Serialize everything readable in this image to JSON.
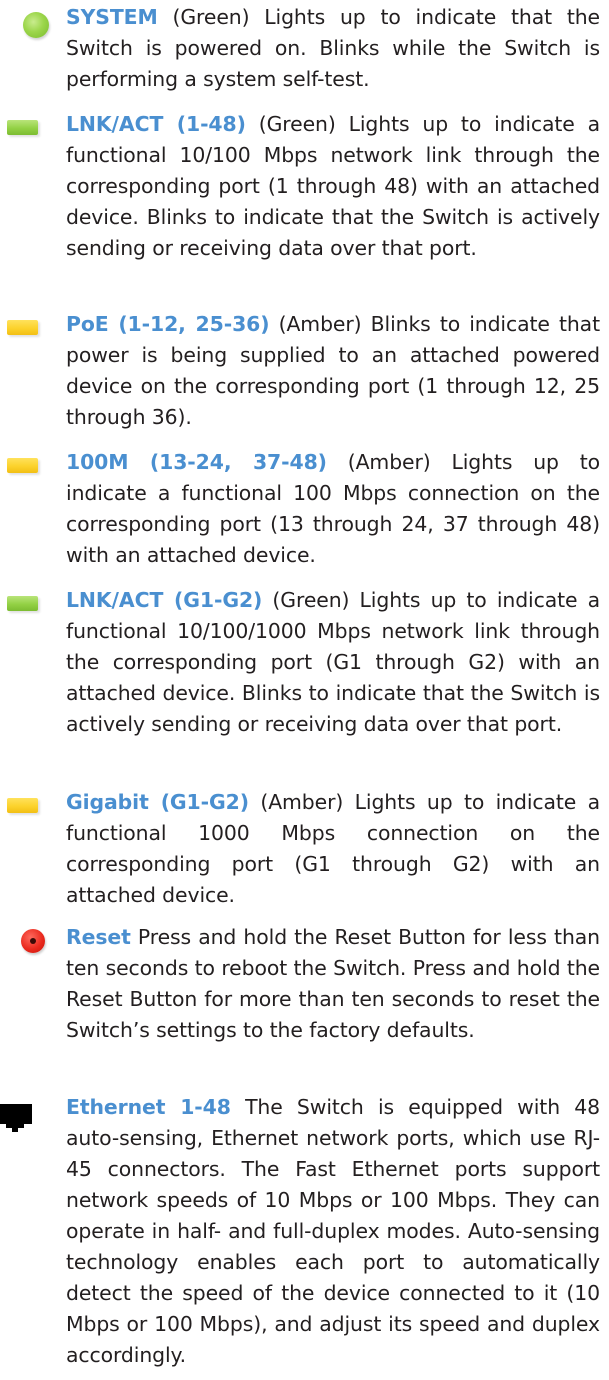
{
  "entries": [
    {
      "icon": "green-led-circle-icon",
      "color": "#9cd64b",
      "term": "SYSTEM",
      "text": " (Green) Lights up to indicate that the Switch is powered on. Blinks while the Switch is performing a system self-test."
    },
    {
      "icon": "green-led-rect-icon",
      "color": "#93d145",
      "term": "LNK/ACT (1-48)",
      "text": " (Green) Lights up to indicate a functional 10/100 Mbps network link through the corresponding port (1 through 48) with an attached device. Blinks to indicate that the Switch is actively sending or receiving data over that port."
    },
    {
      "icon": "amber-led-rect-icon",
      "color": "#fcd22c",
      "term": "PoE (1-12, 25-36)",
      "text": " (Amber) Blinks to indicate that power is being supplied to an attached powered device on the corresponding port (1 through 12, 25 through 36)."
    },
    {
      "icon": "amber-led-rect-icon",
      "color": "#fcd22c",
      "term": "100M (13-24, 37-48)",
      "text": " (Amber) Lights up to indicate a functional 100 Mbps connection on the corresponding port (13 through 24, 37 through 48) with an attached device."
    },
    {
      "icon": "green-led-rect-icon",
      "color": "#93d145",
      "term": "LNK/ACT (G1-G2)",
      "text": " (Green) Lights up to indicate a functional 10/100/1000 Mbps network link through the corresponding port (G1 through G2) with an attached device. Blinks to indicate that the Switch is actively sending or receiving data over that port."
    },
    {
      "icon": "amber-led-rect-icon",
      "color": "#fcd22c",
      "term": "Gigabit (G1-G2)",
      "text": " (Amber) Lights up to indicate a functional 1000 Mbps connection on the corresponding port (G1 through G2) with an attached device."
    },
    {
      "icon": "reset-button-icon",
      "color": "#ea2a1e",
      "term": "Reset",
      "text": " Press and hold the Reset Button for less than ten seconds to reboot the Switch. Press and hold the Reset Button for more than ten seconds to reset the Switch’s settings to the factory defaults."
    },
    {
      "icon": "ethernet-port-icon",
      "color": "#000000",
      "term": "Ethernet 1-48",
      "text": " The Switch is equipped with 48 auto-sensing, Ethernet network ports, which use RJ-45 connectors. The Fast Ethernet ports support network speeds of 10 Mbps or 100 Mbps. They can operate in half- and full-duplex modes. Auto-sensing technology enables each port to automatically detect the speed of the device connected to it (10 Mbps or 100 Mbps), and adjust its speed and duplex accordingly."
    }
  ],
  "colors": {
    "term": "#4a8fd0",
    "body_text": "#231f20"
  }
}
